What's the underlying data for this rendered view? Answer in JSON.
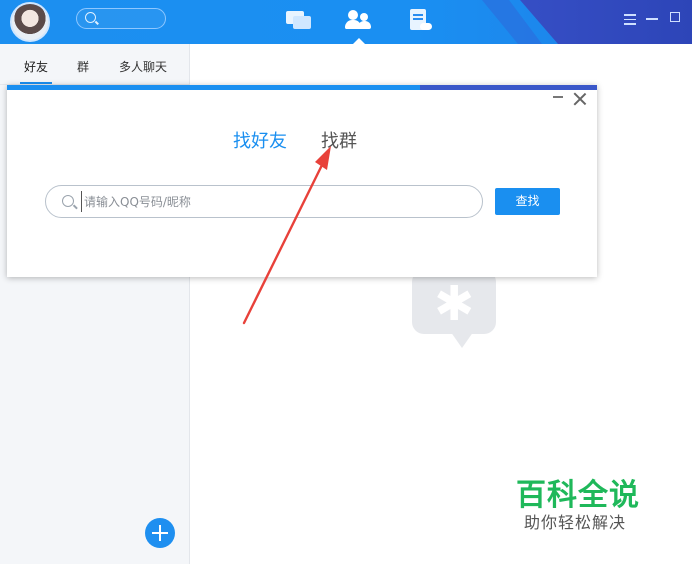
{
  "sidebar": {
    "tabs": [
      {
        "label": "好友"
      },
      {
        "label": "群"
      },
      {
        "label": "多人聊天"
      }
    ]
  },
  "dialog": {
    "tab_friend": "找好友",
    "tab_group": "找群",
    "search_placeholder": "请输入QQ号码/昵称",
    "find_label": "查找"
  },
  "watermark": {
    "title": "百科全说",
    "subtitle": "助你轻松解决"
  },
  "colors": {
    "accent": "#1a8ff0",
    "annotation_arrow": "#e8413a",
    "watermark_green": "#1fb85a"
  },
  "icons": [
    "search-icon",
    "message-icon",
    "contacts-icon",
    "space-icon",
    "menu-icon",
    "minimize-icon",
    "maximize-icon",
    "close-icon",
    "add-icon"
  ]
}
